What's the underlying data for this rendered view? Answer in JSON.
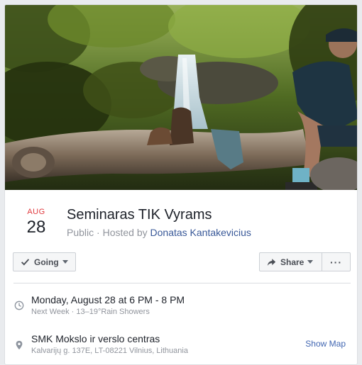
{
  "cover": {
    "accent_colors": [
      "#2d3a1b",
      "#5f7a2c",
      "#c8d9e0",
      "#7a6452"
    ]
  },
  "event": {
    "month": "AUG",
    "day": "28",
    "title": "Seminaras TIK Vyrams",
    "visibility": "Public",
    "hosted_by_prefix": "· Hosted by",
    "host": "Donatas Kantakevicius"
  },
  "actions": {
    "going_label": "Going",
    "share_label": "Share",
    "more_label": "···"
  },
  "time": {
    "icon": "clock-icon",
    "label": "Monday, August 28 at 6 PM - 8 PM",
    "sub": "Next Week · 13–19°Rain Showers"
  },
  "location": {
    "icon": "map-pin-icon",
    "name": "SMK Mokslo ir verslo centras",
    "address": "Kalvarijų g. 137E, LT-08221 Vilnius, Lithuania",
    "show_map_label": "Show Map"
  },
  "colors": {
    "date_month": "#e0393e",
    "link": "#385898",
    "muted": "#90949c",
    "button_bg": "#f5f6f7"
  }
}
